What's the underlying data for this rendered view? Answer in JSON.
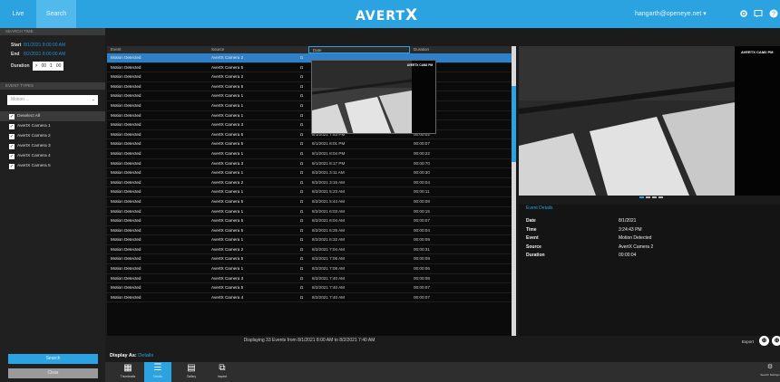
{
  "header": {
    "tabs": [
      {
        "label": "Live"
      },
      {
        "label": "Search"
      }
    ],
    "brand": "AVERT",
    "brand_x": "X",
    "user": "hangarth@openeye.net ▾"
  },
  "filters": {
    "search_heading": "SEARCH TIME",
    "start_label": "Start",
    "start_value": "8/1/2021 8:00:00 AM",
    "end_label": "End",
    "end_value": "8/2/2021 8:00:00 AM",
    "duration_label": "Duration",
    "duration_op": ">",
    "duration_value": "00",
    "duration_unit": "1",
    "duration_secs": "00",
    "event_heading": "EVENT TYPES",
    "event_placeholder": "Motion ...",
    "select_all": "Deselect All",
    "cameras": [
      "AvertX Camera 1",
      "AvertX Camera 2",
      "AvertX Camera 3",
      "AvertX Camera 4",
      "AvertX Camera 5"
    ],
    "search_button": "Search",
    "clear_button": "Clear"
  },
  "table": {
    "columns": [
      "Event",
      "Source",
      "Date",
      "Duration"
    ],
    "rows": [
      {
        "event": "Motion Detected",
        "source": "AvertX Camera 2",
        "date": "",
        "duration": ""
      },
      {
        "event": "Motion Detected",
        "source": "AvertX Camera 5",
        "date": "",
        "duration": ""
      },
      {
        "event": "Motion Detected",
        "source": "AvertX Camera 2",
        "date": "",
        "duration": ""
      },
      {
        "event": "Motion Detected",
        "source": "AvertX Camera 5",
        "date": "",
        "duration": ""
      },
      {
        "event": "Motion Detected",
        "source": "AvertX Camera 1",
        "date": "",
        "duration": ""
      },
      {
        "event": "Motion Detected",
        "source": "AvertX Camera 1",
        "date": "",
        "duration": ""
      },
      {
        "event": "Motion Detected",
        "source": "AvertX Camera 1",
        "date": "",
        "duration": ""
      },
      {
        "event": "Motion Detected",
        "source": "AvertX Camera 3",
        "date": "8/1/2021 7:50 PM",
        "duration": "00:00:12"
      },
      {
        "event": "Motion Detected",
        "source": "AvertX Camera 5",
        "date": "8/1/2021 7:53 PM",
        "duration": "00:00:02"
      },
      {
        "event": "Motion Detected",
        "source": "AvertX Camera 5",
        "date": "8/1/2021 8:01 PM",
        "duration": "00:00:07"
      },
      {
        "event": "Motion Detected",
        "source": "AvertX Camera 1",
        "date": "8/1/2021 8:04 PM",
        "duration": "00:00:22"
      },
      {
        "event": "Motion Detected",
        "source": "AvertX Camera 3",
        "date": "8/1/2021 8:17 PM",
        "duration": "00:00:70"
      },
      {
        "event": "Motion Detected",
        "source": "AvertX Camera 1",
        "date": "8/2/2021 3:11 AM",
        "duration": "00:00:30"
      },
      {
        "event": "Motion Detected",
        "source": "AvertX Camera 2",
        "date": "8/2/2021 3:15 AM",
        "duration": "00:00:04"
      },
      {
        "event": "Motion Detected",
        "source": "AvertX Camera 1",
        "date": "8/2/2021 5:23 AM",
        "duration": "00:00:11"
      },
      {
        "event": "Motion Detected",
        "source": "AvertX Camera 5",
        "date": "8/2/2021 5:44 AM",
        "duration": "00:00:08"
      },
      {
        "event": "Motion Detected",
        "source": "AvertX Camera 1",
        "date": "8/2/2021 6:03 AM",
        "duration": "00:00:15"
      },
      {
        "event": "Motion Detected",
        "source": "AvertX Camera 5",
        "date": "8/2/2021 6:04 AM",
        "duration": "00:00:07"
      },
      {
        "event": "Motion Detected",
        "source": "AvertX Camera 5",
        "date": "8/2/2021 6:25 AM",
        "duration": "00:00:04"
      },
      {
        "event": "Motion Detected",
        "source": "AvertX Camera 1",
        "date": "8/2/2021 6:32 AM",
        "duration": "00:00:09"
      },
      {
        "event": "Motion Detected",
        "source": "AvertX Camera 2",
        "date": "8/2/2021 7:04 AM",
        "duration": "00:00:31"
      },
      {
        "event": "Motion Detected",
        "source": "AvertX Camera 5",
        "date": "8/2/2021 7:06 AM",
        "duration": "00:00:09"
      },
      {
        "event": "Motion Detected",
        "source": "AvertX Camera 1",
        "date": "8/2/2021 7:08 AM",
        "duration": "00:00:06"
      },
      {
        "event": "Motion Detected",
        "source": "AvertX Camera 3",
        "date": "8/2/2021 7:40 AM",
        "duration": "00:00:08"
      },
      {
        "event": "Motion Detected",
        "source": "AvertX Camera 5",
        "date": "8/2/2021 7:40 AM",
        "duration": "00:00:07"
      },
      {
        "event": "Motion Detected",
        "source": "AvertX Camera 4",
        "date": "8/2/2021 7:40 AM",
        "duration": "00:00:07"
      }
    ],
    "footer": "Displaying 33 Events from 8/1/2021 8:00 AM to 8/2/2021 7:40 AM"
  },
  "preview": {
    "label": "AVERTX CAM2 PM"
  },
  "video": {
    "label": "AVERTX CAM2 PM"
  },
  "details": {
    "heading": "Event Details",
    "rows": [
      {
        "key": "Date",
        "value": "8/1/2021"
      },
      {
        "key": "Time",
        "value": "3:24:43 PM"
      },
      {
        "key": "Event",
        "value": "Motion Detected"
      },
      {
        "key": "Source",
        "value": "AvertX Camera 2"
      },
      {
        "key": "Duration",
        "value": "00:00:04"
      }
    ],
    "export": "Export"
  },
  "display_as": {
    "label": "Display As:",
    "value": "Details"
  },
  "bottom_buttons": [
    {
      "label": "Thumbnails",
      "icon": "thumbnails-icon"
    },
    {
      "label": "Details",
      "icon": "details-list-icon"
    },
    {
      "label": "Gallery",
      "icon": "gallery-icon"
    },
    {
      "label": "Inspect",
      "icon": "inspect-icon"
    }
  ],
  "settings_label": "Search Settings",
  "colors": {
    "accent": "#2aa3e0",
    "selected_row": "#2e80c8",
    "background": "#1b1b1b"
  }
}
